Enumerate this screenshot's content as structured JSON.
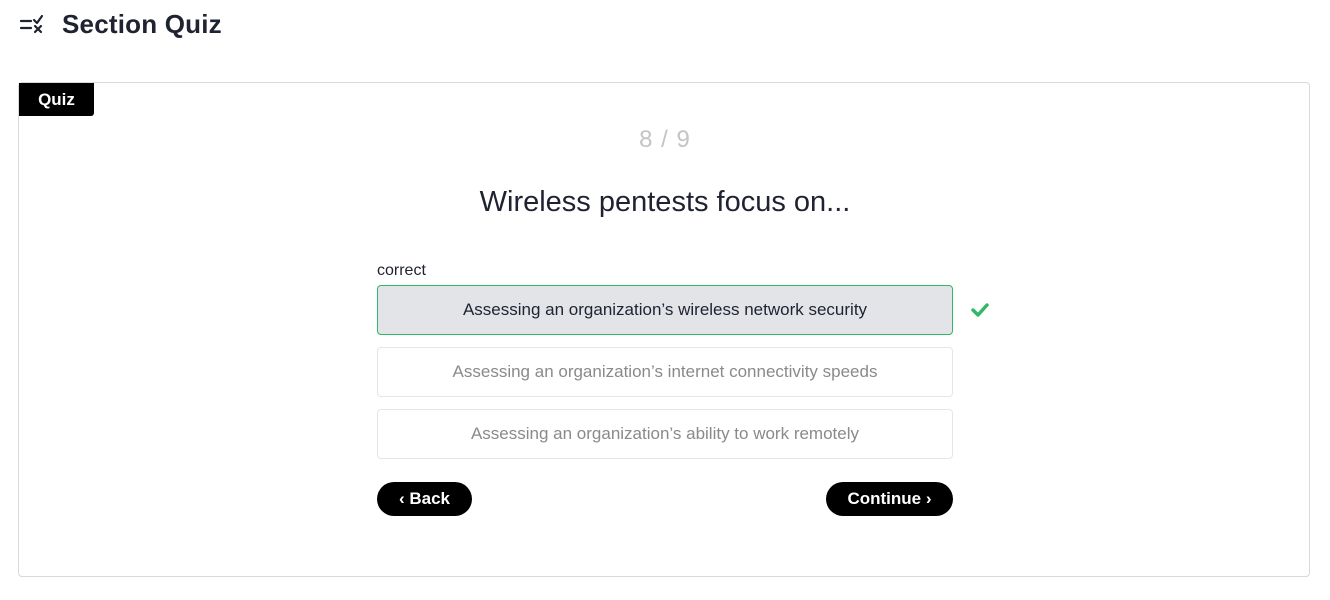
{
  "header": {
    "icon": "checklist-icon",
    "title": "Section Quiz"
  },
  "quiz": {
    "tag": "Quiz",
    "progress": "8 / 9",
    "question": "Wireless pentests focus on...",
    "feedback": "correct",
    "options": [
      {
        "label": "Assessing an organization’s wireless network security",
        "selected": true,
        "correct": true
      },
      {
        "label": "Assessing an organization’s internet connectivity speeds",
        "selected": false
      },
      {
        "label": "Assessing an organization’s ability to work remotely",
        "selected": false
      }
    ],
    "correct_icon": "check-icon",
    "correct_color": "#2fb866",
    "back_label": "‹ Back",
    "continue_label": "Continue ›"
  }
}
